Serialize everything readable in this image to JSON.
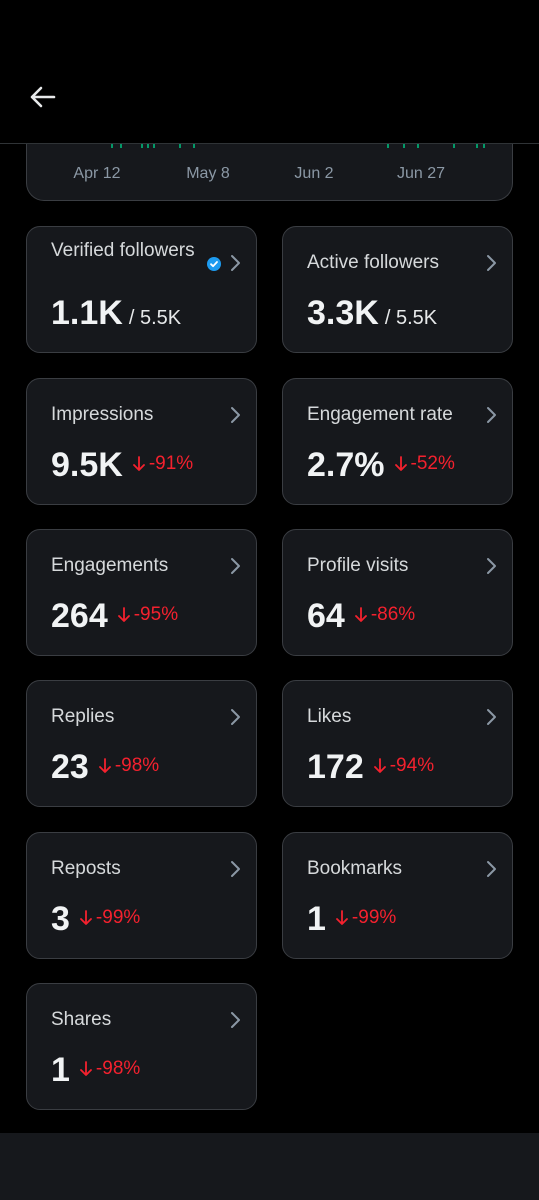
{
  "header": {
    "back_icon": "arrow-left-icon"
  },
  "chart": {
    "x_labels": [
      "Apr 12",
      "May 8",
      "Jun 2",
      "Jun 27"
    ]
  },
  "colors": {
    "accent": "#1d9bf0",
    "negative": "#f4212e",
    "card_bg": "#16181c",
    "border": "#3a3d42"
  },
  "metrics": {
    "verified": {
      "label": "Verified followers",
      "value": "1.1K",
      "total": "/ 5.5K"
    },
    "active": {
      "label": "Active followers",
      "value": "3.3K",
      "total": "/ 5.5K"
    },
    "impressions": {
      "label": "Impressions",
      "value": "9.5K",
      "change": "-91%"
    },
    "engagement_rate": {
      "label": "Engagement rate",
      "value": "2.7%",
      "change": "-52%"
    },
    "engagements": {
      "label": "Engagements",
      "value": "264",
      "change": "-95%"
    },
    "profile_visits": {
      "label": "Profile visits",
      "value": "64",
      "change": "-86%"
    },
    "replies": {
      "label": "Replies",
      "value": "23",
      "change": "-98%"
    },
    "likes": {
      "label": "Likes",
      "value": "172",
      "change": "-94%"
    },
    "reposts": {
      "label": "Reposts",
      "value": "3",
      "change": "-99%"
    },
    "bookmarks": {
      "label": "Bookmarks",
      "value": "1",
      "change": "-99%"
    },
    "shares": {
      "label": "Shares",
      "value": "1",
      "change": "-98%"
    }
  }
}
